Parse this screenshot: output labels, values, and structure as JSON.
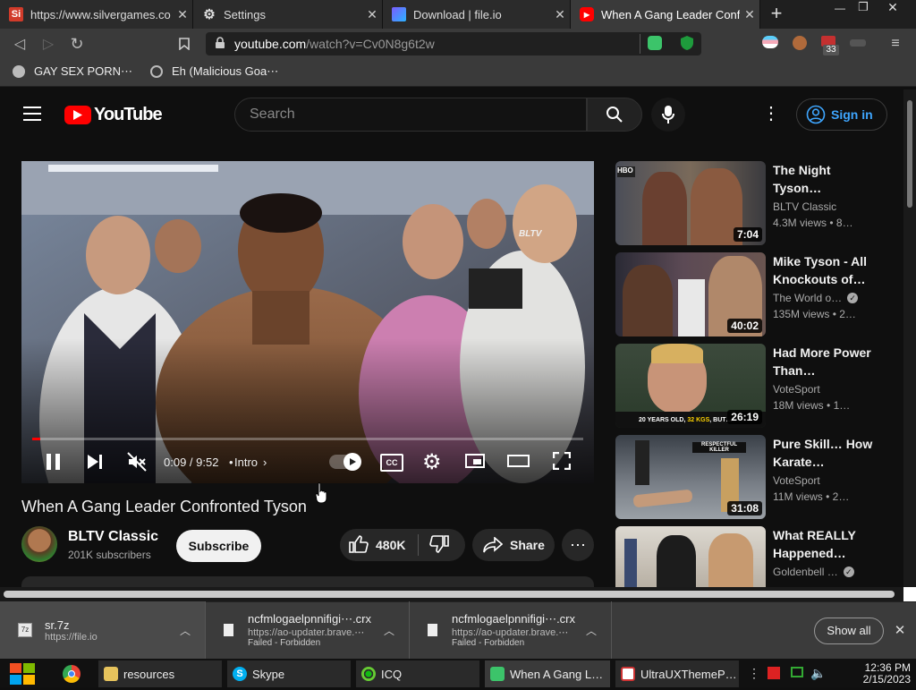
{
  "browser": {
    "tabs": [
      {
        "title": "https://www.silvergames.co",
        "icon": "silvergames-icon"
      },
      {
        "title": "Settings",
        "icon": "gear-icon"
      },
      {
        "title": "Download | file.io",
        "icon": "fileio-icon"
      },
      {
        "title": "When A Gang Leader Confr",
        "icon": "youtube-icon"
      }
    ],
    "url_host": "youtube.com",
    "url_path": "/watch?v=Cv0N8g6t2w",
    "badge_count": "33",
    "bookmarks": [
      {
        "label": "GAY SEX PORN⋯"
      },
      {
        "label": "Eh (Malicious Goa⋯"
      }
    ]
  },
  "youtube": {
    "logo_text": "YouTube",
    "search_placeholder": "Search",
    "sign_in": "Sign in",
    "player": {
      "time": "0:09 / 9:52",
      "chapter": "Intro",
      "progress": 0.015,
      "cc": "CC",
      "watermark": "BLTV"
    },
    "video_title": "When A Gang Leader Confronted Tyson",
    "channel": {
      "name": "BLTV Classic",
      "subscribers": "201K subscribers"
    },
    "subscribe": "Subscribe",
    "likes": "480K",
    "share": "Share",
    "recommendations": [
      {
        "title": "The Night Tyson…",
        "channel": "BLTV Classic",
        "views": "4.3M views",
        "age": "8…",
        "duration": "7:04",
        "verified": false
      },
      {
        "title": "Mike Tyson - All Knockouts of…",
        "channel": "The World o…",
        "views": "135M views",
        "age": "2…",
        "duration": "40:02",
        "verified": true
      },
      {
        "title": "Had More Power Than…",
        "channel": "VoteSport",
        "views": "18M views",
        "age": "1…",
        "duration": "26:19",
        "verified": false
      },
      {
        "title": "Pure Skill… How Karate…",
        "channel": "VoteSport",
        "views": "11M views",
        "age": "2…",
        "duration": "31:08",
        "verified": false
      },
      {
        "title": "What REALLY Happened…",
        "channel": "Goldenbell …",
        "views": "",
        "age": "",
        "duration": "",
        "verified": true
      }
    ]
  },
  "downloads": {
    "items": [
      {
        "name": "sr.7z",
        "url": "https://file.io",
        "status": ""
      },
      {
        "name": "ncfmlogaelpnnifigi⋯.crx",
        "url": "https://ao-updater.brave.⋯",
        "status": "Failed - Forbidden"
      },
      {
        "name": "ncfmlogaelpnnifigi⋯.crx",
        "url": "https://ao-updater.brave.⋯",
        "status": "Failed - Forbidden"
      }
    ],
    "show_all": "Show all"
  },
  "taskbar": {
    "items": [
      {
        "label": "resources",
        "icon": "folder-icon"
      },
      {
        "label": "Skype",
        "icon": "skype-icon"
      },
      {
        "label": "ICQ",
        "icon": "icq-icon"
      },
      {
        "label": "When A Gang L…",
        "icon": "brave-icon"
      },
      {
        "label": "UltraUXThemeP…",
        "icon": "app-window-icon"
      }
    ],
    "time": "12:36 PM",
    "date": "2/15/2023"
  },
  "colors": {
    "youtube_red": "#ff0000",
    "sign_in_blue": "#3ea6ff",
    "dark_bg": "#0f0f0f"
  }
}
